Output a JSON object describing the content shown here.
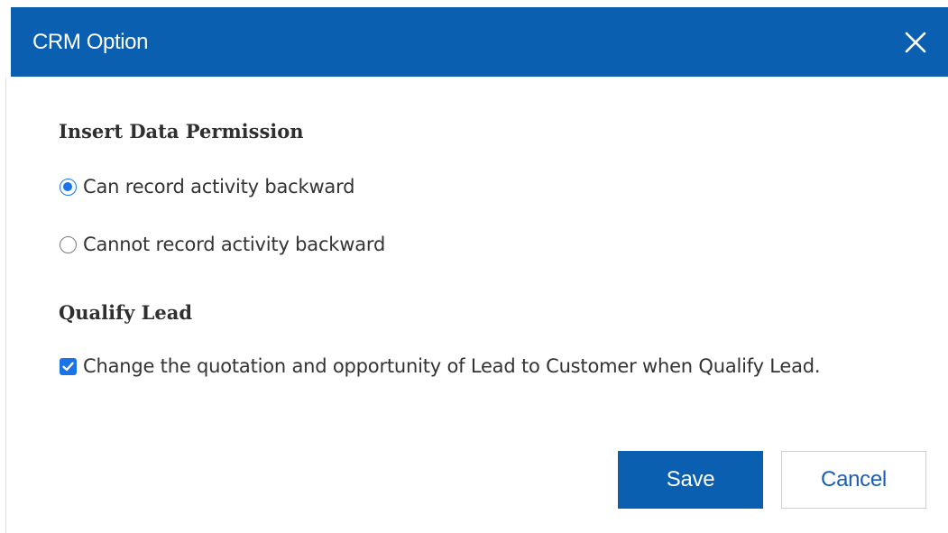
{
  "dialog": {
    "title": "CRM Option",
    "close_icon": "close-icon"
  },
  "insert_permission": {
    "heading": "Insert Data Permission",
    "options": [
      {
        "label": "Can record activity backward",
        "selected": true
      },
      {
        "label": "Cannot record activity backward",
        "selected": false
      }
    ]
  },
  "qualify_lead": {
    "heading": "Qualify Lead",
    "checkbox_label": "Change the quotation and opportunity of Lead to Customer when Qualify Lead.",
    "checked": true
  },
  "buttons": {
    "save_label": "Save",
    "cancel_label": "Cancel"
  },
  "colors": {
    "header": "#0a5fb0",
    "accent": "#1a73e8",
    "cancel_text": "#1a5fb4"
  }
}
